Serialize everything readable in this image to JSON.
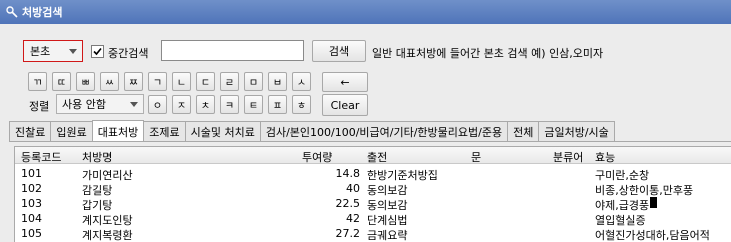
{
  "window": {
    "title": "처방검색"
  },
  "search": {
    "category_value": "본초",
    "partial_label": "중간검색",
    "partial_checked": true,
    "input_value": "",
    "button_label": "검색",
    "hint": "일반 대표처방에 들어간 본초 검색 예) 인삼,오미자"
  },
  "keypad": {
    "row1": [
      "ㄲ",
      "ㄸ",
      "ㅃ",
      "ㅆ",
      "ㅉ",
      "ㄱ",
      "ㄴ",
      "ㄷ",
      "ㄹ",
      "ㅁ",
      "ㅂ",
      "ㅅ"
    ],
    "row2": [
      "ㅇ",
      "ㅈ",
      "ㅊ",
      "ㅋ",
      "ㅌ",
      "ㅍ",
      "ㅎ"
    ],
    "back_label": "←",
    "clear_label": "Clear"
  },
  "sort": {
    "label": "정렬",
    "value": "사용 안함"
  },
  "tabs": [
    "진찰료",
    "입원료",
    "대표처방",
    "조제료",
    "시술및 처치료",
    "검사/본인100/100/비급여/기타/한방물리요법/준용",
    "전체",
    "금일처방/시술"
  ],
  "active_tab": 2,
  "grid": {
    "columns": {
      "code": "등록코드",
      "name": "처방명",
      "dose": "투여량",
      "source": "출전",
      "q": "문",
      "category": "분류어",
      "effect": "효능"
    },
    "rows": [
      {
        "code": "101",
        "name": "가미연리산",
        "dose": "14.8",
        "source": "한방기준처방집",
        "effect": "구미란,순창"
      },
      {
        "code": "102",
        "name": "감길탕",
        "dose": "40",
        "source": "동의보감",
        "effect": "비종,상한이통,만후풍"
      },
      {
        "code": "103",
        "name": "갑기탕",
        "dose": "22.5",
        "source": "동의보감",
        "effect": "야제,급경풍"
      },
      {
        "code": "104",
        "name": "계지도인탕",
        "dose": "42",
        "source": "단계심법",
        "effect": "열입혈실증"
      },
      {
        "code": "105",
        "name": "계지복령환",
        "dose": "27.2",
        "source": "금궤요략",
        "effect": "어혈진가성대하,담음어적"
      }
    ]
  }
}
